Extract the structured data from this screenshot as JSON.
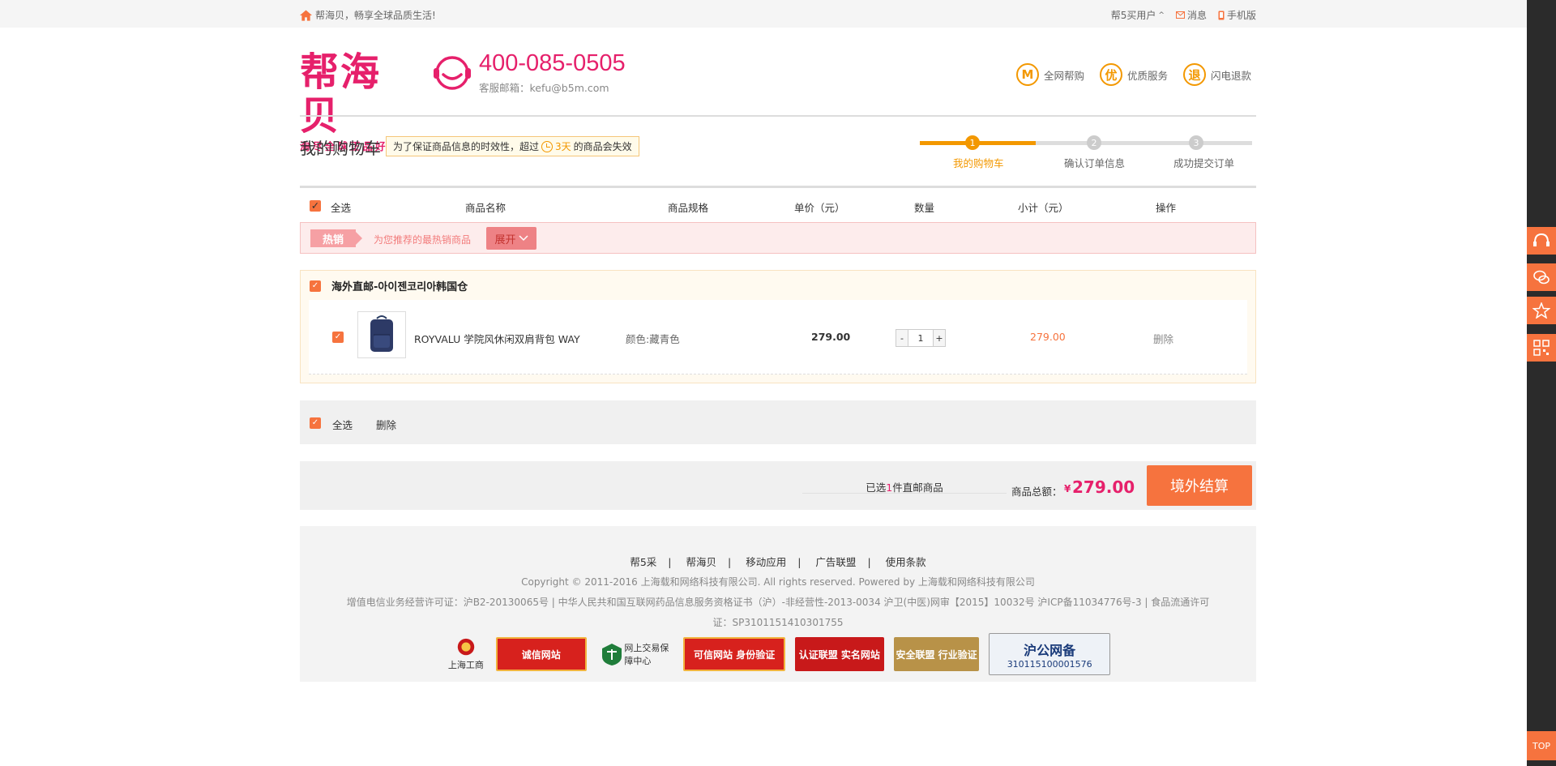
{
  "topbar": {
    "welcome": "帮海贝，畅享全球品质生活!",
    "user": "帮5买用户",
    "messages": "消息",
    "mobile": "手机版"
  },
  "header": {
    "logo_text": "帮海贝",
    "logo_slogan": "淘尽全球正品好货",
    "phone": "400-085-0505",
    "email": "客服邮箱：kefu@b5m.com",
    "services": [
      {
        "icon_char": "M",
        "label": "全网帮购"
      },
      {
        "icon_char": "优",
        "label": "优质服务"
      },
      {
        "icon_char": "退",
        "label": "闪电退款"
      }
    ]
  },
  "cart": {
    "title": "我的购物车",
    "notice_prefix": "为了保证商品信息的时效性，超过",
    "notice_days": "3天",
    "notice_suffix": "的商品会失效"
  },
  "steps": [
    {
      "num": "1",
      "label": "我的购物车",
      "active": true
    },
    {
      "num": "2",
      "label": "确认订单信息",
      "active": false
    },
    {
      "num": "3",
      "label": "成功提交订单",
      "active": false
    }
  ],
  "table_header": {
    "select_all": "全选",
    "name": "商品名称",
    "spec": "商品规格",
    "price": "单价（元）",
    "qty": "数量",
    "subtotal": "小计（元）",
    "action": "操作"
  },
  "hot": {
    "tag": "热销",
    "text": "为您推荐的最热销商品",
    "expand": "展开"
  },
  "shop": {
    "name": "海外直邮-아이젠코리아韩国仓",
    "items": [
      {
        "name": "ROYVALU 学院风休闲双肩背包 WAY",
        "spec": "颜色:藏青色",
        "price": "279.00",
        "qty": "1",
        "subtotal": "279.00",
        "action": "删除"
      }
    ]
  },
  "batch": {
    "select_all": "全选",
    "delete": "删除"
  },
  "summary": {
    "selected_prefix": "已选",
    "selected_count": "1",
    "selected_suffix": "件直邮商品",
    "total_label": "商品总额：",
    "currency": "¥",
    "total": "279.00",
    "checkout": "境外结算"
  },
  "footer": {
    "links": [
      "帮5采",
      "帮海贝",
      "移动应用",
      "广告联盟",
      "使用条款"
    ],
    "copyright": "Copyright © 2011-2016 上海载和网络科技有限公司. All rights reserved. Powered by 上海载和网络科技有限公司",
    "license_line1": "增值电信业务经营许可证：沪B2-20130065号 | 中华人民共和国互联网药品信息服务资格证书（沪）-非经营性-2013-0034 沪卫(中医)网审【2015】10032号 沪ICP备11034776号-3 | 食品流通许可",
    "license_line2": "证：SP3101151410301755",
    "badges": [
      {
        "label": "上海工商"
      },
      {
        "label": "诚信网站"
      },
      {
        "label": "网上交易保障中心"
      },
      {
        "label": "可信网站 身份验证"
      },
      {
        "label": "认证联盟 实名网站"
      },
      {
        "label": "安全联盟 行业验证"
      },
      {
        "label": "沪公网备",
        "sub": "310115100001576"
      }
    ]
  },
  "sidebar": {
    "top": "TOP"
  },
  "colors": {
    "brand": "#e6206b",
    "accent": "#f6733e",
    "orange": "#f39800"
  }
}
